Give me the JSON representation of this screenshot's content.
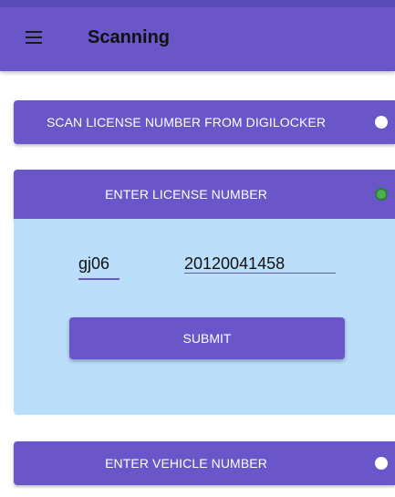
{
  "app_bar": {
    "title": "Scanning",
    "menu_icon": "hamburger-menu-icon"
  },
  "options": [
    {
      "label": "SCAN LICENSE NUMBER FROM DIGILOCKER",
      "selected": false
    },
    {
      "label": "ENTER LICENSE NUMBER",
      "selected": true
    },
    {
      "label": "ENTER VEHICLE NUMBER",
      "selected": false
    }
  ],
  "form": {
    "state_code": "gj06",
    "license_number": "20120041458",
    "submit_label": "SUBMIT"
  },
  "colors": {
    "primary": "#6a55c9",
    "panel": "#bbdefb",
    "radio_selected": "#4caf50"
  }
}
